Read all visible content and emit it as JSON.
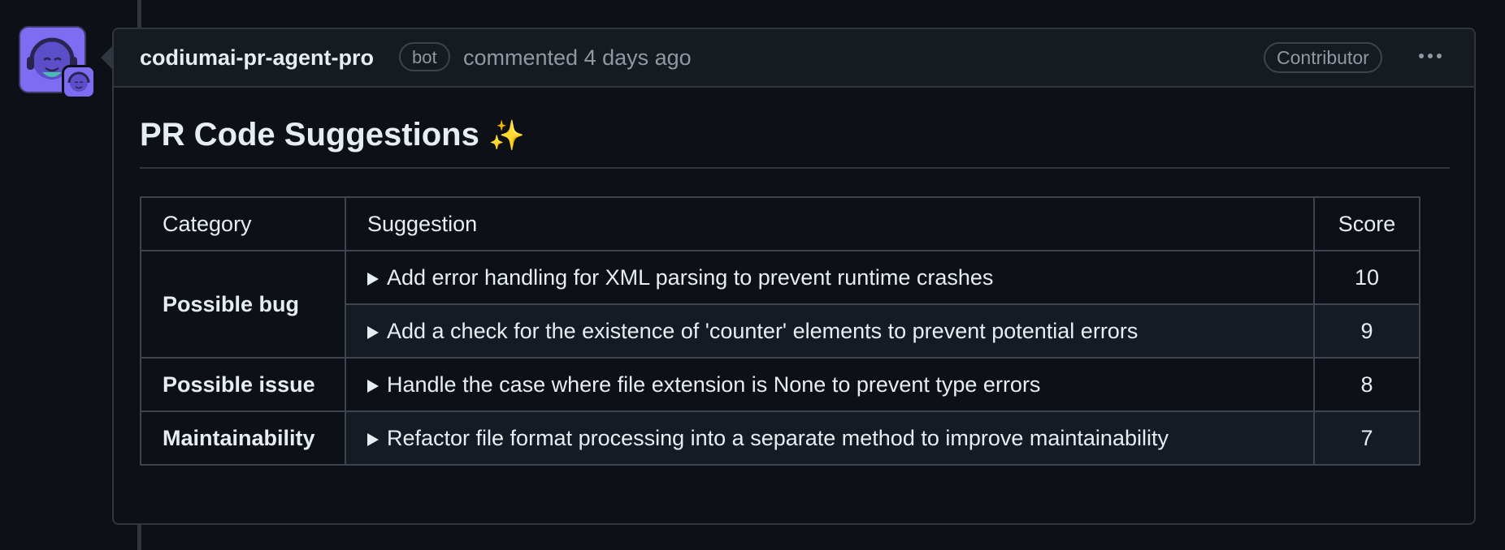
{
  "comment": {
    "author": "codiumai-pr-agent-pro",
    "author_badge": "bot",
    "timestamp": "commented 4 days ago",
    "role_badge": "Contributor",
    "menu_icon": "kebab-horizontal-icon"
  },
  "body": {
    "heading": "PR Code Suggestions",
    "heading_emoji": "✨"
  },
  "table": {
    "headers": [
      "Category",
      "Suggestion",
      "Score"
    ],
    "rows": [
      {
        "category": "Possible bug",
        "suggestion": "Add error handling for XML parsing to prevent runtime crashes",
        "score": "10"
      },
      {
        "category": "",
        "suggestion": "Add a check for the existence of 'counter' elements to prevent potential errors",
        "score": "9"
      },
      {
        "category": "Possible issue",
        "suggestion": "Handle the case where file extension is None to prevent type errors",
        "score": "8"
      },
      {
        "category": "Maintainability",
        "suggestion": "Refactor file format processing into a separate method to improve maintainability",
        "score": "7"
      }
    ]
  },
  "colors": {
    "background": "#0d1117",
    "header_bg": "#161b22",
    "border": "#30363d",
    "avatar_accent": "#7e6cf2"
  }
}
